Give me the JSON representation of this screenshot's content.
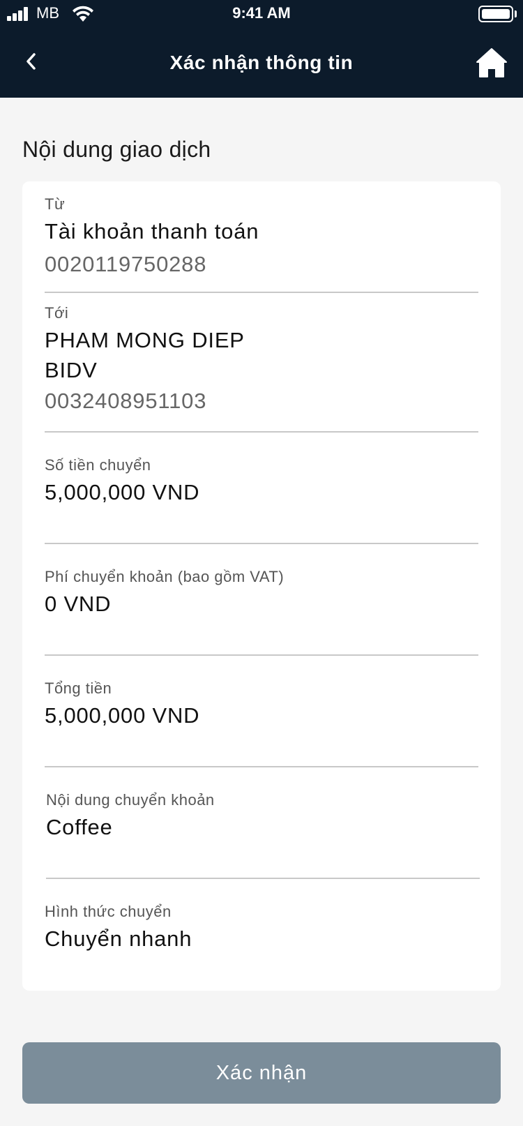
{
  "status_bar": {
    "carrier": "MB",
    "time": "9:41 AM"
  },
  "nav": {
    "title": "Xác nhận thông tin",
    "back_icon": "chevron-left-icon",
    "home_icon": "home-icon"
  },
  "section_title": "Nội dung giao dịch",
  "from": {
    "label": "Từ",
    "account_name": "Tài khoản thanh toán",
    "account_number": "0020119750288"
  },
  "to": {
    "label": "Tới",
    "name": "PHAM MONG DIEP",
    "bank": "BIDV",
    "account_number": "0032408951103"
  },
  "amount": {
    "label": "Số tiền chuyển",
    "value": "5,000,000 VND"
  },
  "fee": {
    "label": "Phí chuyển khoản (bao gồm VAT)",
    "value": "0 VND"
  },
  "total": {
    "label": "Tổng tiền",
    "value": "5,000,000 VND"
  },
  "message": {
    "label": "Nội dung chuyển khoản",
    "value": "Coffee"
  },
  "method": {
    "label": "Hình thức chuyển",
    "value": "Chuyển nhanh"
  },
  "confirm_button": "Xác nhận",
  "colors": {
    "header_bg": "#0c1b2b",
    "page_bg": "#f5f5f5",
    "button_bg": "#7b8d9a"
  }
}
